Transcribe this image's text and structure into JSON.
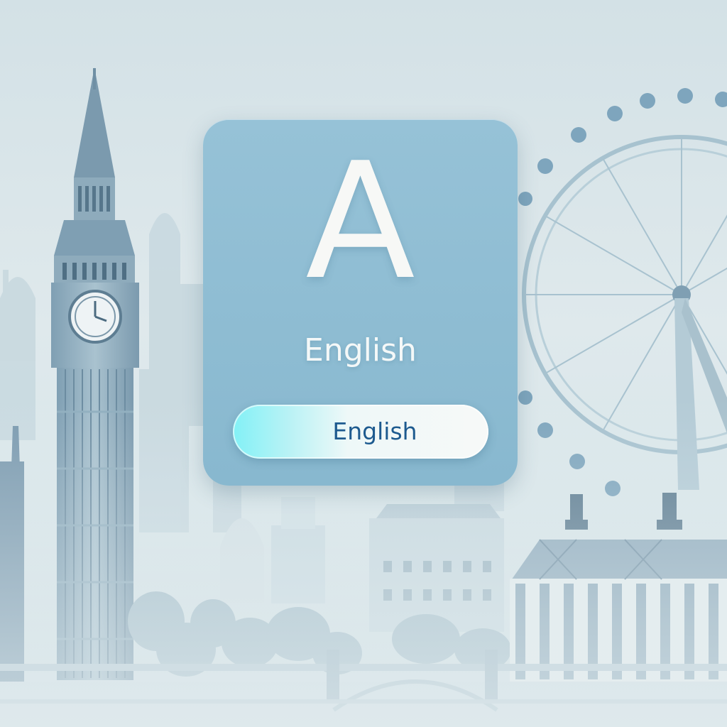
{
  "card": {
    "letter": "A",
    "title": "English"
  },
  "language_button": {
    "label": "English"
  },
  "colors": {
    "card": "#8fbdd3",
    "pill_accent": "#82f1f6",
    "pill_text": "#1d5a8f"
  },
  "icons": [
    "big-ben-illustration",
    "london-eye-illustration",
    "palace-illustration",
    "bridge-illustration"
  ]
}
